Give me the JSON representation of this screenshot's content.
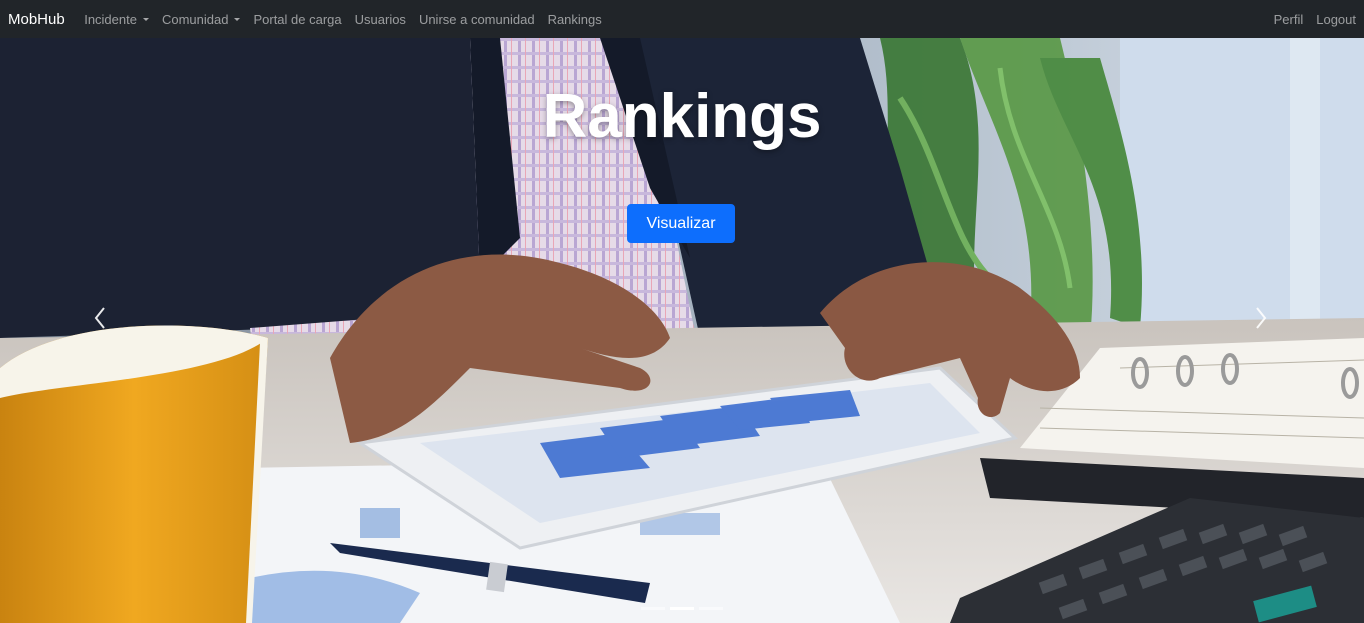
{
  "navbar": {
    "brand": "MobHub",
    "items": [
      {
        "label": "Incidente",
        "dropdown": true
      },
      {
        "label": "Comunidad",
        "dropdown": true
      },
      {
        "label": "Portal de carga",
        "dropdown": false
      },
      {
        "label": "Usuarios",
        "dropdown": false
      },
      {
        "label": "Unirse a comunidad",
        "dropdown": false
      },
      {
        "label": "Rankings",
        "dropdown": false
      }
    ],
    "right": [
      {
        "label": "Perfil"
      },
      {
        "label": "Logout"
      }
    ],
    "background": "#212529",
    "link_color": "rgba(255,255,255,0.55)"
  },
  "carousel": {
    "title": "Rankings",
    "button": "Visualizar",
    "button_color": "#0d6efd",
    "prev_icon": "chevron-left-icon",
    "next_icon": "chevron-right-icon",
    "slide_count": 3,
    "active_slide": 2
  }
}
